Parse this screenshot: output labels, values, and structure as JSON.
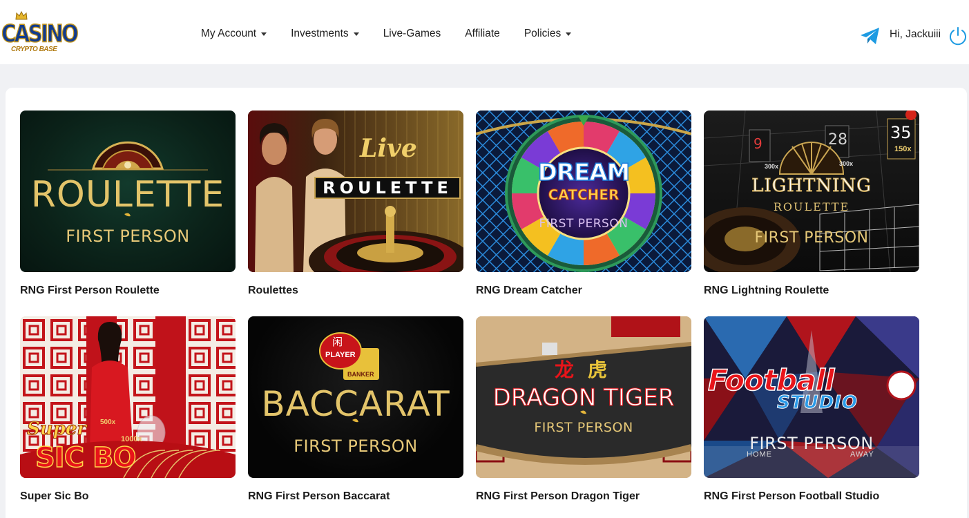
{
  "brand": {
    "name": "CASINO",
    "tagline": "CRYPTO BASE"
  },
  "nav": {
    "items": [
      {
        "label": "My Account",
        "dropdown": true
      },
      {
        "label": "Investments",
        "dropdown": true
      },
      {
        "label": "Live-Games",
        "dropdown": false
      },
      {
        "label": "Affiliate",
        "dropdown": false
      },
      {
        "label": "Policies",
        "dropdown": true
      }
    ]
  },
  "user": {
    "greeting": "Hi, Jackuiii"
  },
  "icons": {
    "telegram": "telegram-icon",
    "logout": "power-icon",
    "dropdown": "caret-down-icon"
  },
  "colors": {
    "accent_blue": "#1e9be2",
    "brand_navy": "#123b8c",
    "brand_gold": "#c99a1e"
  },
  "games": [
    {
      "title": "RNG First Person Roulette",
      "art": {
        "main": "ROULETTE",
        "sub": "FIRST PERSON"
      }
    },
    {
      "title": "Roulettes",
      "art": {
        "main": "ROULETTE",
        "script": "Live"
      }
    },
    {
      "title": "RNG Dream Catcher",
      "art": {
        "main": "DREAM",
        "second": "CATCHER",
        "sub": "FIRST PERSON"
      }
    },
    {
      "title": "RNG Lightning Roulette",
      "art": {
        "main": "LIGHTNING",
        "second": "ROULETTE",
        "sub": "FIRST PERSON",
        "num_a": "9",
        "num_b": "28",
        "num_c": "35",
        "mult_c": "150x",
        "mult_a": "300x",
        "mult_b": "300x"
      }
    },
    {
      "title": "Super Sic Bo",
      "art": {
        "script": "Super",
        "main": "SIC BO",
        "mult_a": "500x",
        "mult_b": "1000x"
      }
    },
    {
      "title": "RNG First Person Baccarat",
      "art": {
        "main": "BACCARAT",
        "sub": "FIRST PERSON",
        "chip_a": "PLAYER",
        "chip_b": "BANKER",
        "glyph": "闲"
      }
    },
    {
      "title": "RNG First Person Dragon Tiger",
      "art": {
        "main": "DRAGON TIGER",
        "sub": "FIRST PERSON",
        "glyph_a": "龙",
        "glyph_b": "虎"
      }
    },
    {
      "title": "RNG First Person Football Studio",
      "art": {
        "main": "Football",
        "second": "STUDIO",
        "sub": "FIRST PERSON",
        "home": "HOME",
        "away": "AWAY"
      }
    }
  ]
}
